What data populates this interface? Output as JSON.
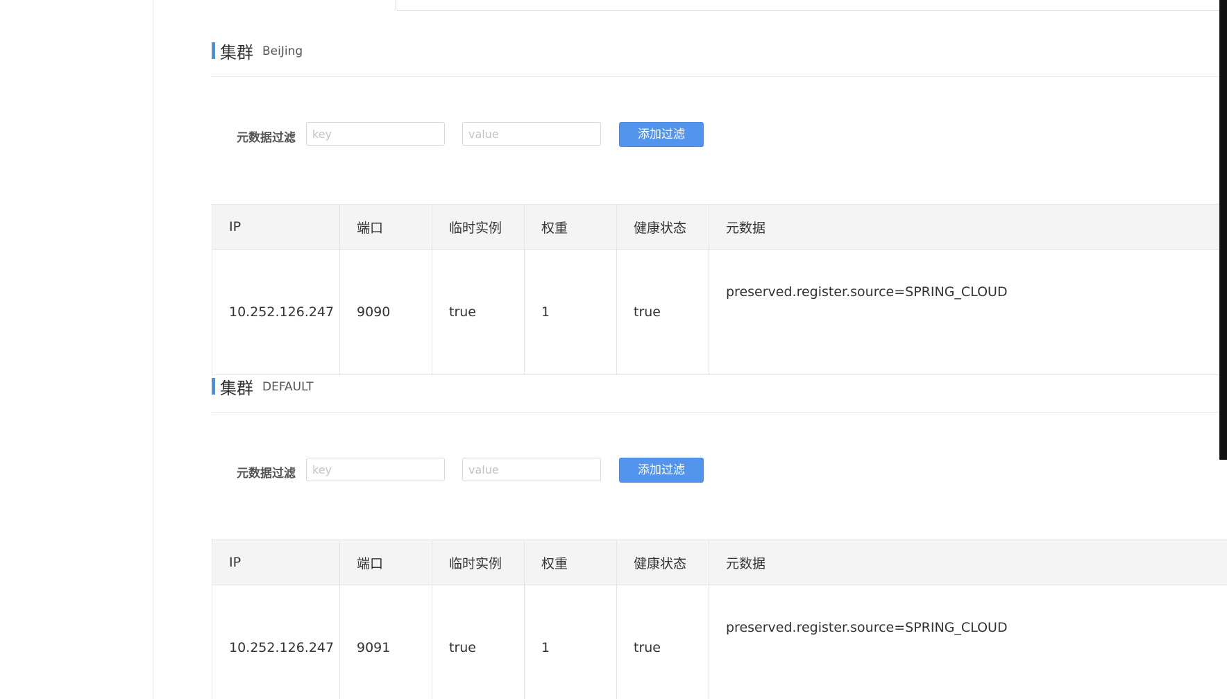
{
  "clusters": [
    {
      "title": "集群",
      "name": "BeiJing",
      "filter": {
        "label": "元数据过滤",
        "key_placeholder": "key",
        "value_placeholder": "value",
        "add_label": "添加过滤"
      },
      "columns": [
        "IP",
        "端口",
        "临时实例",
        "权重",
        "健康状态",
        "元数据"
      ],
      "rows": [
        {
          "ip": "10.252.126.247",
          "port": "9090",
          "ephemeral": "true",
          "weight": "1",
          "healthy": "true",
          "metadata": "preserved.register.source=SPRING_CLOUD"
        }
      ]
    },
    {
      "title": "集群",
      "name": "DEFAULT",
      "filter": {
        "label": "元数据过滤",
        "key_placeholder": "key",
        "value_placeholder": "value",
        "add_label": "添加过滤"
      },
      "columns": [
        "IP",
        "端口",
        "临时实例",
        "权重",
        "健康状态",
        "元数据"
      ],
      "rows": [
        {
          "ip": "10.252.126.247",
          "port": "9091",
          "ephemeral": "true",
          "weight": "1",
          "healthy": "true",
          "metadata": "preserved.register.source=SPRING_CLOUD"
        }
      ]
    }
  ],
  "colors": {
    "accent": "#4a90e2",
    "button": "#5394ec",
    "header_bg": "#f4f4f4"
  }
}
